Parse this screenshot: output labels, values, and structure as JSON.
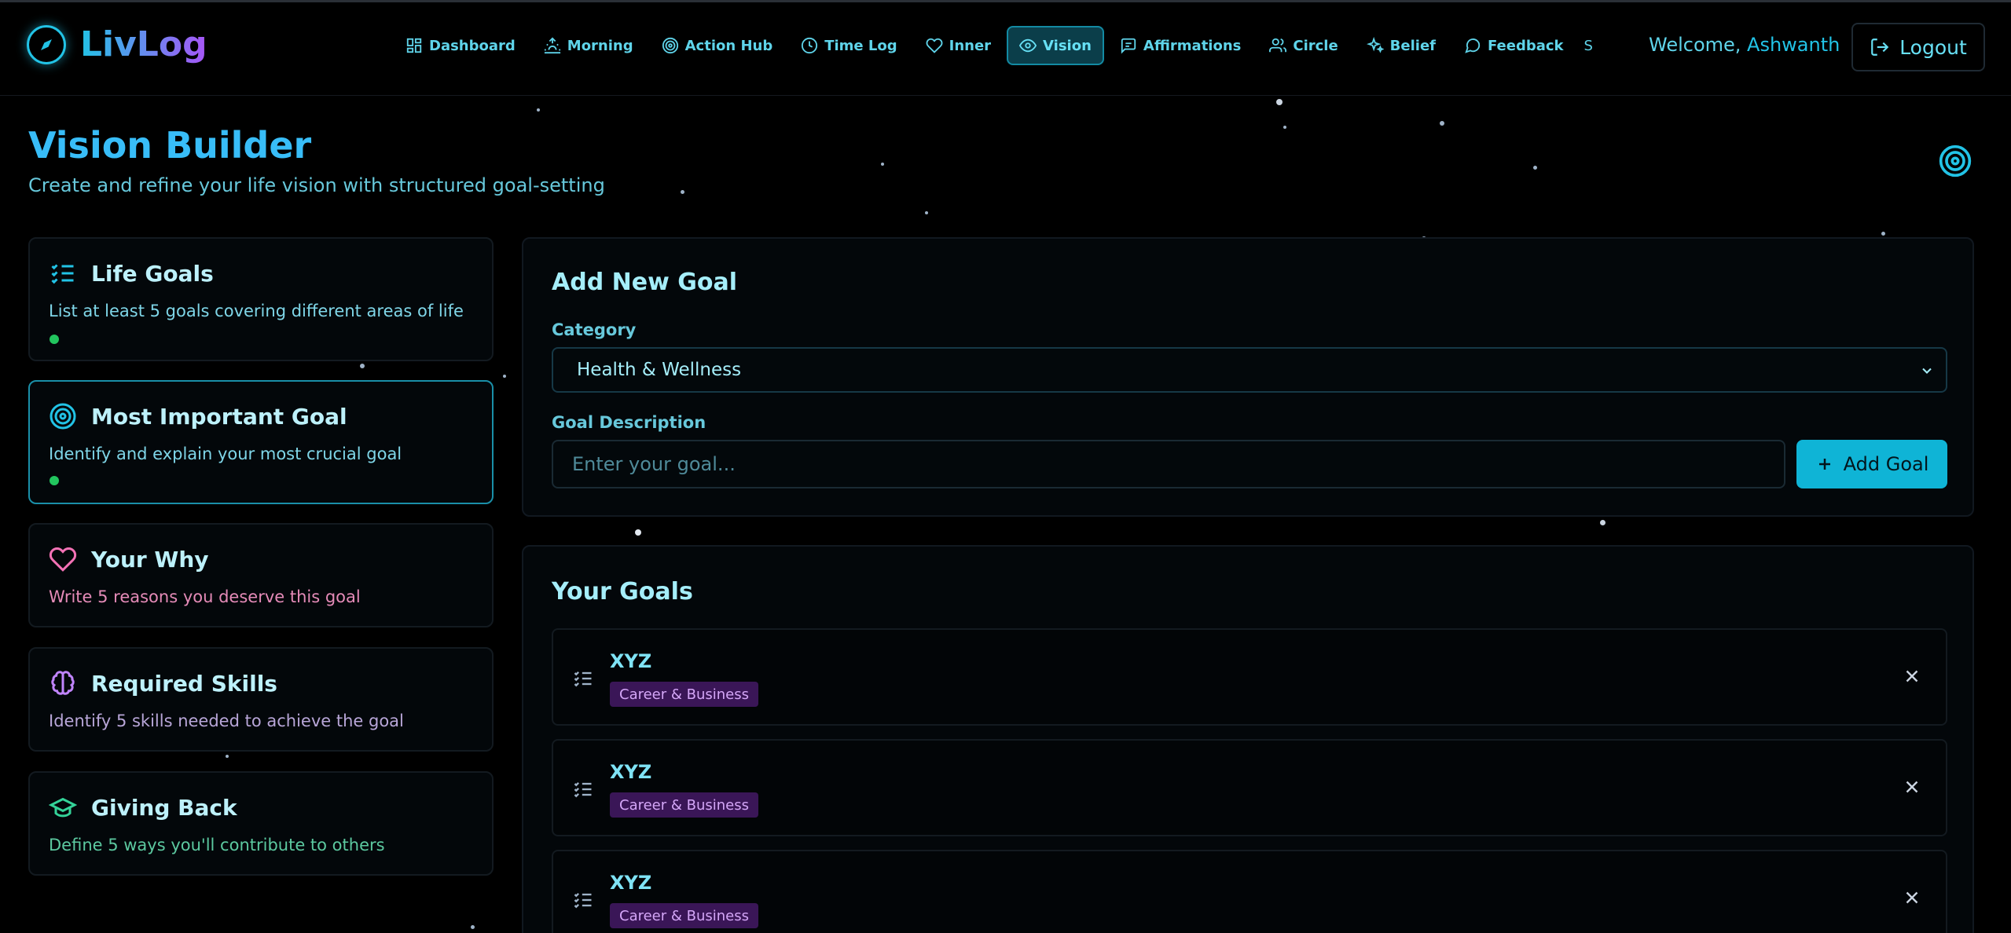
{
  "app": {
    "name": "LivLog"
  },
  "nav": {
    "items": [
      {
        "label": "Dashboard",
        "icon": "grid-icon"
      },
      {
        "label": "Morning",
        "icon": "sunrise-icon"
      },
      {
        "label": "Action Hub",
        "icon": "target-icon"
      },
      {
        "label": "Time Log",
        "icon": "clock-icon"
      },
      {
        "label": "Inner",
        "icon": "heart-icon"
      },
      {
        "label": "Vision",
        "icon": "eye-icon",
        "active": true
      },
      {
        "label": "Affirmations",
        "icon": "message-square-icon"
      },
      {
        "label": "Circle",
        "icon": "users-icon"
      },
      {
        "label": "Belief",
        "icon": "sparkles-icon"
      },
      {
        "label": "Feedback",
        "icon": "message-circle-icon"
      }
    ],
    "overflow": "S"
  },
  "user": {
    "welcome_prefix": "Welcome, ",
    "name": "Ashwanth",
    "logout_label": "Logout"
  },
  "header": {
    "title": "Vision Builder",
    "subtitle": "Create and refine your life vision with structured goal-setting"
  },
  "steps": [
    {
      "title": "Life Goals",
      "description": "List at least 5 goals covering different areas of life",
      "icon": "list-checks-icon",
      "color": "#22c3e6",
      "desc_color": "#7fd6e8",
      "complete": true,
      "active": false
    },
    {
      "title": "Most Important Goal",
      "description": "Identify and explain your most crucial goal",
      "icon": "target-icon",
      "color": "#22c3e6",
      "desc_color": "#7fd6e8",
      "complete": true,
      "active": true
    },
    {
      "title": "Your Why",
      "description": "Write 5 reasons you deserve this goal",
      "icon": "heart-icon",
      "color": "#f472b6",
      "desc_color": "#e58bb8",
      "complete": false,
      "active": false
    },
    {
      "title": "Required Skills",
      "description": "Identify 5 skills needed to achieve the goal",
      "icon": "brain-icon",
      "color": "#c084fc",
      "desc_color": "#b8a6d8",
      "complete": false,
      "active": false
    },
    {
      "title": "Giving Back",
      "description": "Define 5 ways you'll contribute to others",
      "icon": "graduation-cap-icon",
      "color": "#34d399",
      "desc_color": "#5cc9a0",
      "complete": false,
      "active": false
    }
  ],
  "add_goal": {
    "title": "Add New Goal",
    "category_label": "Category",
    "category_value": "Health & Wellness",
    "description_label": "Goal Description",
    "description_placeholder": "Enter your goal...",
    "button_label": "Add Goal"
  },
  "goals_section": {
    "title": "Your Goals",
    "goals": [
      {
        "title": "XYZ",
        "category": "Career & Business"
      },
      {
        "title": "XYZ",
        "category": "Career & Business"
      },
      {
        "title": "XYZ",
        "category": "Career & Business"
      }
    ]
  },
  "colors": {
    "accent": "#22c3e6",
    "background": "#000000",
    "success_dot": "#22c55e",
    "tag_bg": "#3a1657",
    "tag_text": "#d4a6f7"
  }
}
